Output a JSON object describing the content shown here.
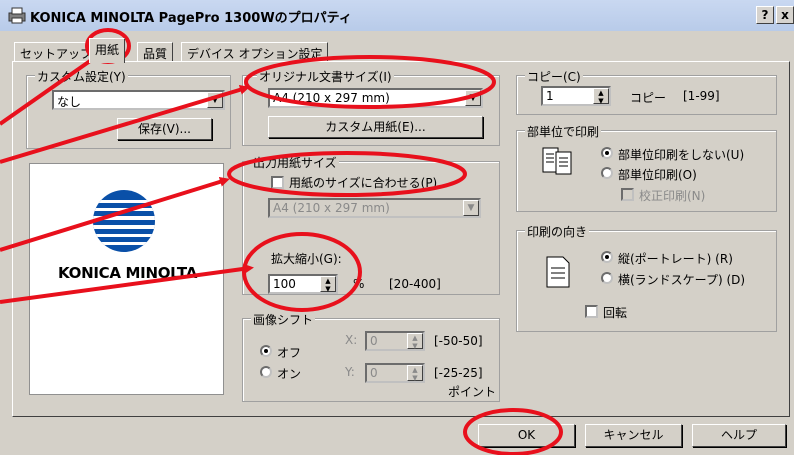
{
  "window": {
    "title": "KONICA MINOLTA PagePro 1300Wのプロパティ",
    "help_label": "?",
    "close_label": "x"
  },
  "tabs": [
    {
      "label": "セットアップ"
    },
    {
      "label": "用紙"
    },
    {
      "label": "品質"
    },
    {
      "label": "デバイス オプション設定"
    }
  ],
  "custom_settings": {
    "label": "カスタム設定(Y)",
    "value": "なし",
    "save_button": "保存(V)..."
  },
  "original_size": {
    "label": "オリジナル文書サイズ(I)",
    "value": "A4 (210 x 297 mm)",
    "custom_paper_button": "カスタム用紙(E)..."
  },
  "output_size": {
    "label": "出力用紙サイズ",
    "fit_checkbox": "用紙のサイズに合わせる(P)",
    "value": "A4 (210 x 297 mm)"
  },
  "zoom": {
    "label": "拡大縮小(G):",
    "value": "100",
    "unit": "%",
    "range": "[20-400]"
  },
  "image_shift": {
    "label": "画像シフト",
    "off": "オフ",
    "on": "オン",
    "x_label": "X:",
    "x_value": "0",
    "x_range": "[-50-50]",
    "y_label": "Y:",
    "y_value": "0",
    "y_range": "[-25-25]",
    "unit": "ポイント"
  },
  "copies": {
    "label": "コピー(C)",
    "value": "1",
    "unit": "コピー",
    "range": "[1-99]"
  },
  "collate": {
    "label": "部単位で印刷",
    "opt_off": "部単位印刷をしない(U)",
    "opt_on": "部単位印刷(O)",
    "proof": "校正印刷(N)"
  },
  "orientation": {
    "label": "印刷の向き",
    "portrait": "縦(ポートレート) (R)",
    "landscape": "横(ランドスケープ) (D)",
    "rotate": "回転"
  },
  "logo": {
    "text": "KONICA MINOLTA"
  },
  "footer": {
    "ok": "OK",
    "cancel": "キャンセル",
    "help": "ヘルプ"
  },
  "colors": {
    "annotation": "#e8101c",
    "logo_blue": "#0a50a8",
    "dialog": "#d4d0c8"
  }
}
